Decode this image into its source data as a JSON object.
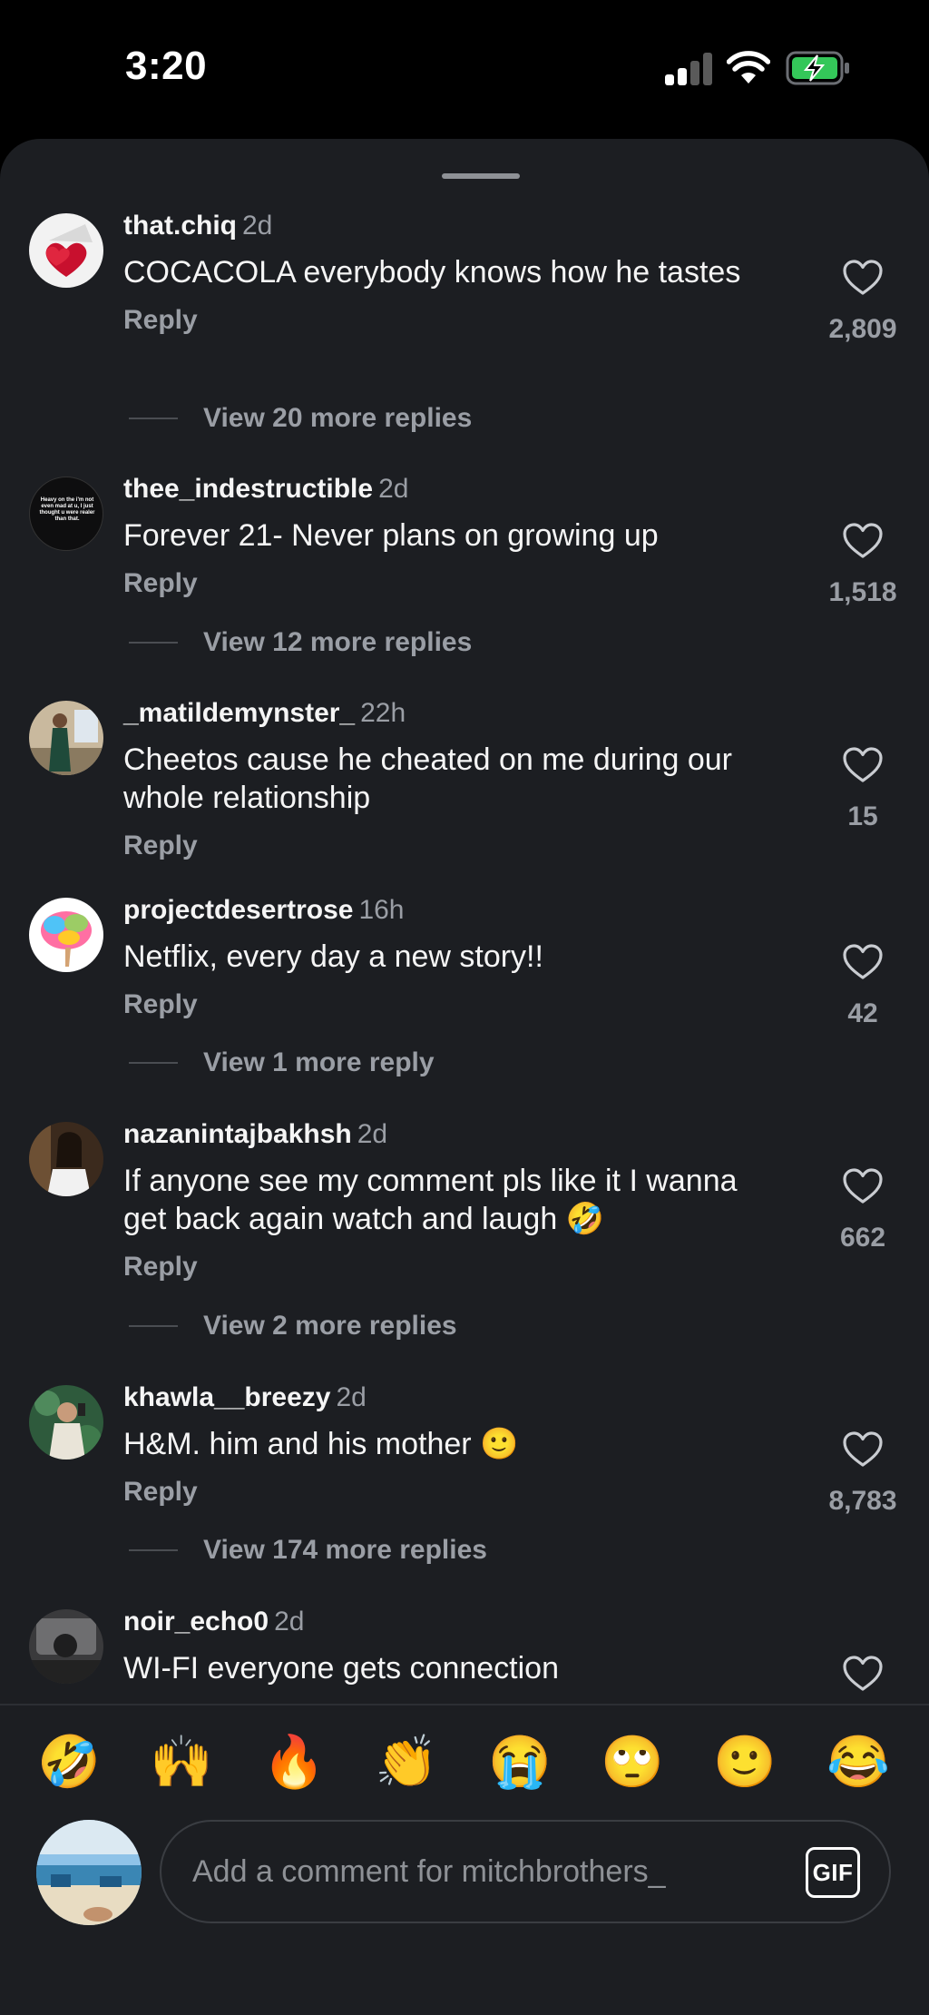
{
  "status_bar": {
    "time": "3:20",
    "icons": [
      "cellular-signal-icon",
      "wifi-icon",
      "battery-charging-icon"
    ]
  },
  "comments": [
    {
      "username": "that.chiq",
      "age": "2d",
      "text": "COCACOLA  everybody knows how he tastes",
      "reply_label": "Reply",
      "likes": "2,809",
      "view_more": "View 20 more replies"
    },
    {
      "username": "thee_indestructible",
      "age": "2d",
      "text": "Forever 21- Never plans on growing up",
      "reply_label": "Reply",
      "likes": "1,518",
      "view_more": "View 12 more replies",
      "avatar_text": "Heavy on the i'm not even mad at u, I just thought u were realer than that."
    },
    {
      "username": "_matildemynster_",
      "age": "22h",
      "text": "Cheetos cause he cheated on me during our whole relationship",
      "reply_label": "Reply",
      "likes": "15"
    },
    {
      "username": "projectdesertrose",
      "age": "16h",
      "text": "Netflix, every day a new story!!",
      "reply_label": "Reply",
      "likes": "42",
      "view_more": "View 1 more reply"
    },
    {
      "username": "nazanintajbakhsh",
      "age": "2d",
      "text": "If anyone see my comment pls like it I wanna get back again watch and laugh 🤣",
      "reply_label": "Reply",
      "likes": "662",
      "view_more": "View 2 more replies"
    },
    {
      "username": "khawla__breezy",
      "age": "2d",
      "text": "H&M. him and his mother 🙂",
      "reply_label": "Reply",
      "likes": "8,783",
      "view_more": "View 174 more replies"
    },
    {
      "username": "noir_echo0",
      "age": "2d",
      "text": "WI-FI everyone gets connection"
    }
  ],
  "emoji_bar": [
    "🤣",
    "🙌",
    "🔥",
    "👏",
    "😭",
    "🙄",
    "🙂",
    "😂"
  ],
  "composer": {
    "placeholder": "Add a comment for mitchbrothers_",
    "gif_label": "GIF"
  },
  "colors": {
    "background": "#000000",
    "sheet": "#1c1e22",
    "text_primary": "#f5f5f5",
    "text_secondary": "#9a9ea5",
    "battery_accent": "#34c759"
  }
}
